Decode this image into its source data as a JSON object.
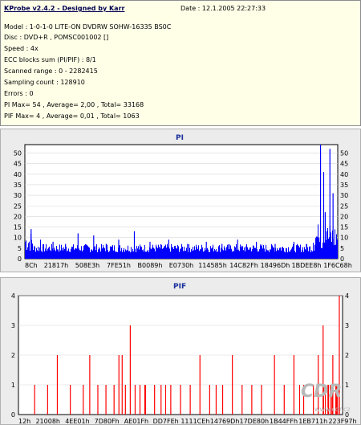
{
  "info": {
    "title": "KProbe v2.4.2 - Designed by Karr",
    "date": "Date : 12.1.2005 22:27:33",
    "lines": [
      "Model : 1-0-1-0 LITE-ON DVDRW SOHW-16335 BS0C",
      "Disc : DVD+R , POMSC001002 []",
      "Speed : 4x",
      "ECC blocks sum (PI/PIF) : 8/1",
      "Scanned range : 0 - 2282415",
      "Sampling count : 128910",
      "Errors : 0",
      "PI Max= 54 , Average= 2,00 , Total= 33168",
      "PIF Max= 4 , Average= 0,01 , Total= 1063"
    ]
  },
  "pi_chart": {
    "title": "PI",
    "y_ticks": [
      "0",
      "5",
      "10",
      "15",
      "20",
      "25",
      "30",
      "35",
      "40",
      "45",
      "50"
    ],
    "x_ticks": [
      "8Ch",
      "21817h",
      "508E3h",
      "7FE51h",
      "B0089h",
      "E0730h",
      "114585h",
      "14C82Fh",
      "18496Dh",
      "1BDEE8h",
      "1F6C68h"
    ],
    "bar_color": "#0000ff"
  },
  "pif_chart": {
    "title": "PIF",
    "y_ticks": [
      "0",
      "1",
      "2",
      "3",
      "4"
    ],
    "x_ticks": [
      "12h",
      "21008h",
      "4EE01h",
      "7D80Fh",
      "AE01Fh",
      "DD7FEh",
      "1111CEh",
      "14769Dh",
      "17DE80h",
      "1B44FFh",
      "1EB711h",
      "223F97h"
    ],
    "bar_color": "#ff0000"
  },
  "chart_data": [
    {
      "type": "bar",
      "title": "PI",
      "xlabel": "",
      "ylabel": "",
      "ylim": [
        0,
        54
      ],
      "x_ticks": [
        "8Ch",
        "21817h",
        "508E3h",
        "7FE51h",
        "B0089h",
        "E0730h",
        "114585h",
        "14C82Fh",
        "18496Dh",
        "1BDEE8h",
        "1F6C68h"
      ],
      "series": [
        {
          "name": "PI",
          "x_positions": [
            0.02,
            0.05,
            0.09,
            0.13,
            0.17,
            0.22,
            0.26,
            0.3,
            0.35,
            0.4,
            0.46,
            0.52,
            0.58,
            0.63,
            0.68,
            0.74,
            0.8,
            0.86,
            0.9,
            0.93,
            0.94,
            0.945,
            0.955,
            0.96,
            0.965,
            0.975,
            0.985
          ],
          "values": [
            14,
            9,
            8,
            7,
            12,
            11,
            7,
            9,
            13,
            8,
            9,
            7,
            8,
            7,
            9,
            8,
            7,
            8,
            7,
            9,
            10,
            54,
            41,
            22,
            13,
            52,
            31
          ]
        }
      ]
    },
    {
      "type": "bar",
      "title": "PIF",
      "xlabel": "",
      "ylabel": "",
      "ylim": [
        0,
        4
      ],
      "x_ticks": [
        "12h",
        "21008h",
        "4EE01h",
        "7D80Fh",
        "AE01Fh",
        "DD7FEh",
        "1111CEh",
        "14769Dh",
        "17DE80h",
        "1B44FFh",
        "1EB711h",
        "223F97h"
      ],
      "series": [
        {
          "name": "PIF",
          "x_positions": [
            0.05,
            0.09,
            0.12,
            0.16,
            0.2,
            0.22,
            0.245,
            0.27,
            0.295,
            0.31,
            0.32,
            0.33,
            0.345,
            0.36,
            0.375,
            0.39,
            0.42,
            0.44,
            0.47,
            0.5,
            0.53,
            0.56,
            0.59,
            0.61,
            0.63,
            0.66,
            0.69,
            0.72,
            0.75,
            0.79,
            0.82,
            0.85,
            0.88,
            0.91,
            0.925,
            0.94,
            0.955,
            0.97,
            0.98,
            0.99
          ],
          "values": [
            1,
            1,
            2,
            1,
            1,
            2,
            1,
            1,
            1,
            2,
            2,
            1,
            3,
            1,
            1,
            1,
            1,
            1,
            1,
            1,
            1,
            2,
            1,
            1,
            1,
            2,
            1,
            1,
            1,
            2,
            1,
            2,
            1,
            1,
            2,
            3,
            1,
            2,
            1,
            4
          ]
        }
      ]
    }
  ],
  "watermark": {
    "logo": "CDR",
    "url": "www.cdr.cz"
  }
}
